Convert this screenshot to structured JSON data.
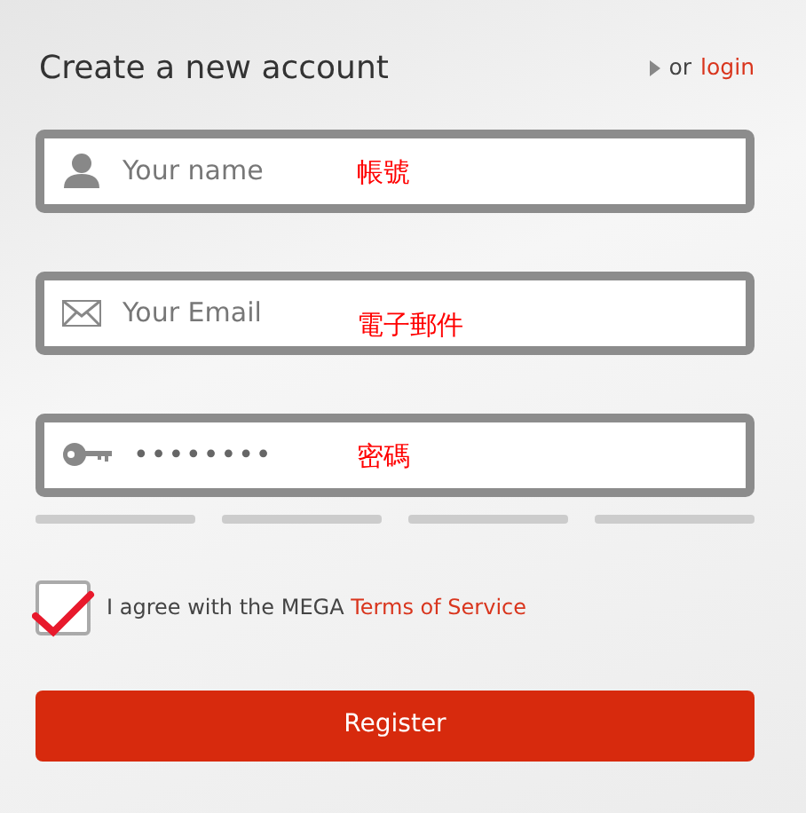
{
  "title": "Create a new account",
  "login": {
    "prefix": "or",
    "link": "login"
  },
  "fields": [
    {
      "kind": "name",
      "placeholder": "Your name",
      "annotation": "帳號"
    },
    {
      "kind": "email",
      "placeholder": "Your Email",
      "annotation": "電子郵件"
    },
    {
      "kind": "password",
      "value": "••••••••",
      "annotation": "密碼"
    }
  ],
  "agree": {
    "checked": true,
    "text": "I agree with the MEGA",
    "link": "Terms of Service"
  },
  "button": "Register"
}
